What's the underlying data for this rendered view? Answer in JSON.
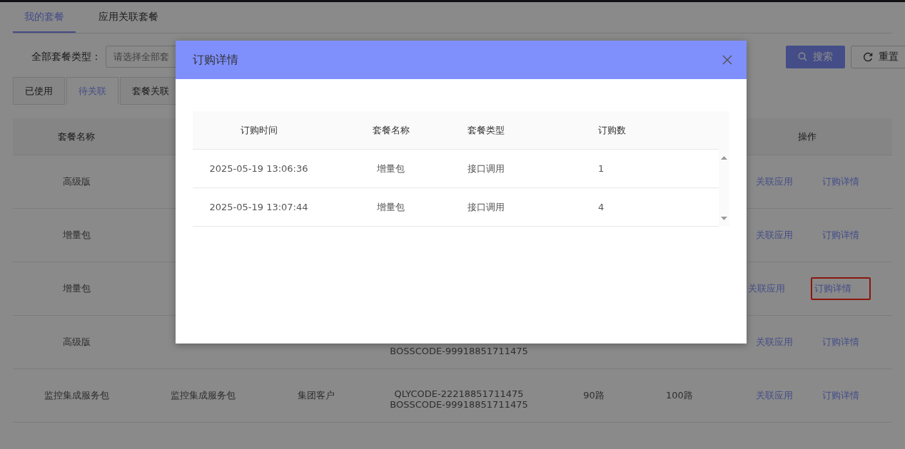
{
  "top_tabs": [
    {
      "label": "我的套餐",
      "selected": true
    },
    {
      "label": "应用关联套餐",
      "selected": false
    }
  ],
  "filter": {
    "label": "全部套餐类型：",
    "placeholder": "请选择全部套"
  },
  "buttons": [
    {
      "kind": "search",
      "label": "搜索"
    },
    {
      "kind": "reset",
      "label": "重置"
    }
  ],
  "status_tabs": [
    {
      "label": "已使用",
      "selected": false
    },
    {
      "label": "待关联",
      "selected": true
    },
    {
      "label": "套餐关联",
      "selected": false
    }
  ],
  "table": {
    "header": {
      "column_1": "套餐名称",
      "actions": "操作"
    },
    "rows": [
      {
        "name": "高级版",
        "actions": [
          {
            "label": "关联应用",
            "highlighted": false
          },
          {
            "label": "订购详情",
            "highlighted": false
          }
        ]
      },
      {
        "name": "增量包",
        "actions": [
          {
            "label": "关联应用",
            "highlighted": false
          },
          {
            "label": "订购详情",
            "highlighted": false
          }
        ]
      },
      {
        "name": "增量包",
        "actions": [
          {
            "label": "关联应用",
            "highlighted": false
          },
          {
            "label": "订购详情",
            "highlighted": true
          }
        ]
      },
      {
        "name": "高级版",
        "codes": [
          "BOSSCODE-99918851711475"
        ],
        "actions": [
          {
            "label": "关联应用",
            "highlighted": false
          },
          {
            "label": "订购详情",
            "highlighted": false
          }
        ]
      },
      {
        "name": "监控集成服务包",
        "column_2": "监控集成服务包",
        "column_3": "集团客户",
        "codes": [
          "QLYCODE-22218851711475",
          "BOSSCODE-99918851711475"
        ],
        "column_5": "90路",
        "column_6": "100路",
        "actions": [
          {
            "label": "关联应用",
            "highlighted": false
          },
          {
            "label": "订购详情",
            "highlighted": false
          }
        ]
      }
    ]
  },
  "dialog": {
    "title": "订购详情",
    "columns": [
      "订购时间",
      "套餐名称",
      "套餐类型",
      "订购数"
    ],
    "rows": [
      [
        "2025-05-19 13:06:36",
        "增量包",
        "接口调用",
        "1"
      ],
      [
        "2025-05-19 13:07:44",
        "增量包",
        "接口调用",
        "4"
      ]
    ]
  }
}
